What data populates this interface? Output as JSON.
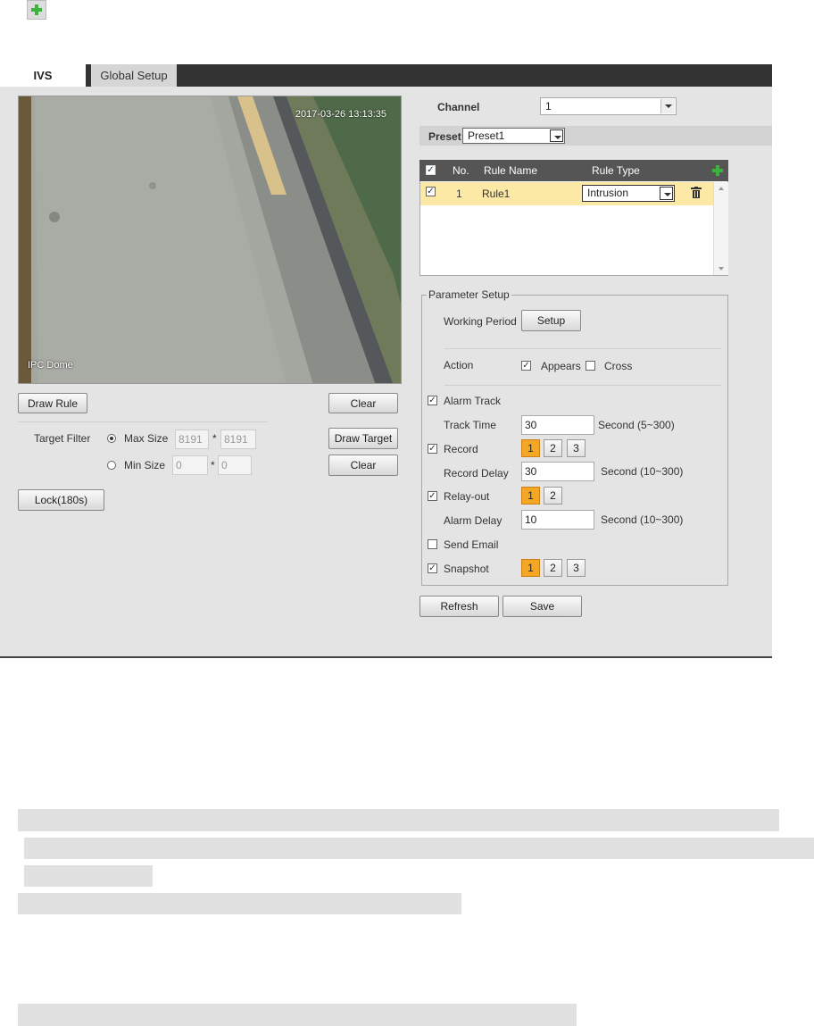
{
  "tabs": {
    "ivs": "IVS",
    "global_setup": "Global Setup"
  },
  "video": {
    "timestamp": "2017-03-26 13:13:35",
    "camera": "IPC Dome"
  },
  "left": {
    "draw_rule": "Draw Rule",
    "clear": "Clear",
    "target_filter_label": "Target Filter",
    "max_size_label": "Max Size",
    "max_w": "8191",
    "max_h": "8191",
    "min_size_label": "Min Size",
    "min_w": "0",
    "min_h": "0",
    "times": "*",
    "draw_target": "Draw Target",
    "clear2": "Clear",
    "lock": "Lock(180s)"
  },
  "channel": {
    "label": "Channel",
    "value": "1"
  },
  "preset": {
    "label": "Preset",
    "value": "Preset1"
  },
  "rule_table": {
    "headers": {
      "no": "No.",
      "name": "Rule Name",
      "type": "Rule Type"
    },
    "rows": [
      {
        "no": "1",
        "name": "Rule1",
        "type": "Intrusion",
        "checked": true
      }
    ]
  },
  "params": {
    "legend": "Parameter Setup",
    "working_period": "Working Period",
    "setup": "Setup",
    "action": "Action",
    "appears": "Appears",
    "cross": "Cross",
    "alarm_track": "Alarm Track",
    "track_time": "Track Time",
    "track_time_value": "30",
    "track_time_unit": "Second (5~300)",
    "record": "Record",
    "record_delay": "Record Delay",
    "record_delay_value": "30",
    "record_delay_unit": "Second (10~300)",
    "relay_out": "Relay-out",
    "alarm_delay": "Alarm Delay",
    "alarm_delay_value": "10",
    "alarm_delay_unit": "Second (10~300)",
    "send_email": "Send Email",
    "snapshot": "Snapshot",
    "n1": "1",
    "n2": "2",
    "n3": "3"
  },
  "footer": {
    "refresh": "Refresh",
    "save": "Save"
  },
  "colors": {
    "accent": "#f5a623",
    "selected_row": "#fde9a6",
    "tab_bar": "#333333",
    "add_icon": "#3cb43c"
  }
}
